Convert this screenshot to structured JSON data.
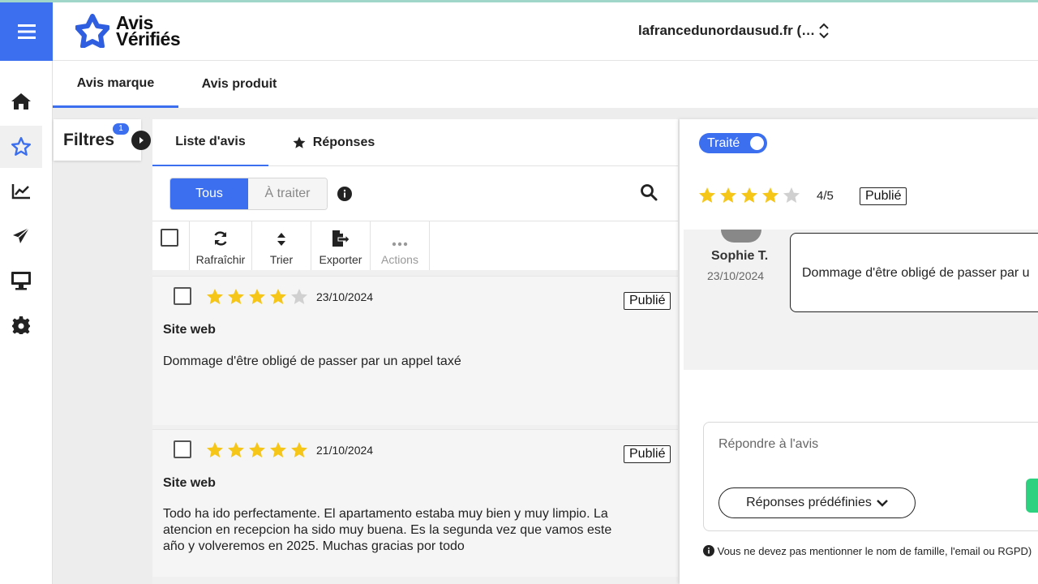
{
  "app": {
    "logo_line1": "Avis",
    "logo_line2": "Vérifiés",
    "site_selector": "lafrancedunordausud.fr (…"
  },
  "sidebar": {
    "items": [
      {
        "icon": "home-icon"
      },
      {
        "icon": "star-icon",
        "active": true
      },
      {
        "icon": "chart-icon"
      },
      {
        "icon": "send-icon"
      },
      {
        "icon": "monitor-icon"
      },
      {
        "icon": "gear-icon"
      }
    ]
  },
  "main_tabs": [
    {
      "label": "Avis marque",
      "active": true
    },
    {
      "label": "Avis produit",
      "active": false
    }
  ],
  "filters": {
    "label": "Filtres",
    "count": "1"
  },
  "sub_tabs": [
    {
      "label": "Liste d'avis",
      "active": true
    },
    {
      "label": "Réponses",
      "active": false
    }
  ],
  "segment": {
    "all": "Tous",
    "to_process": "À traiter"
  },
  "toolbar": {
    "refresh": "Rafraîchir",
    "sort": "Trier",
    "export": "Exporter",
    "actions": "Actions"
  },
  "reviews": [
    {
      "rating": 4,
      "date": "23/10/2024",
      "status": "Publié",
      "source": "Site web",
      "text": "Dommage d'être obligé de passer par un appel taxé"
    },
    {
      "rating": 5,
      "date": "21/10/2024",
      "status": "Publié",
      "source": "Site web",
      "text": "Todo ha ido perfectamente. El apartamento estaba muy bien y muy limpio. La atencion en recepcion ha sido muy buena. Es la segunda vez que vamos este año y volveremos en 2025. Muchas gracias por todo"
    }
  ],
  "detail": {
    "toggle_label": "Traité",
    "rating": 4,
    "score": "4/5",
    "status": "Publié",
    "reviewer_name": "Sophie T.",
    "reviewer_date": "23/10/2024",
    "review_text": "Dommage d'être obligé de passer par u",
    "reply_placeholder": "Répondre à l'avis",
    "predefined_label": "Réponses prédéfinies",
    "gdpr_note": "Vous ne devez pas mentionner le nom de famille, l'email ou RGPD)"
  },
  "colors": {
    "accent": "#3b6ff0",
    "star": "#f5c518",
    "star_empty": "#d0d0d0",
    "success": "#2ed17f"
  }
}
